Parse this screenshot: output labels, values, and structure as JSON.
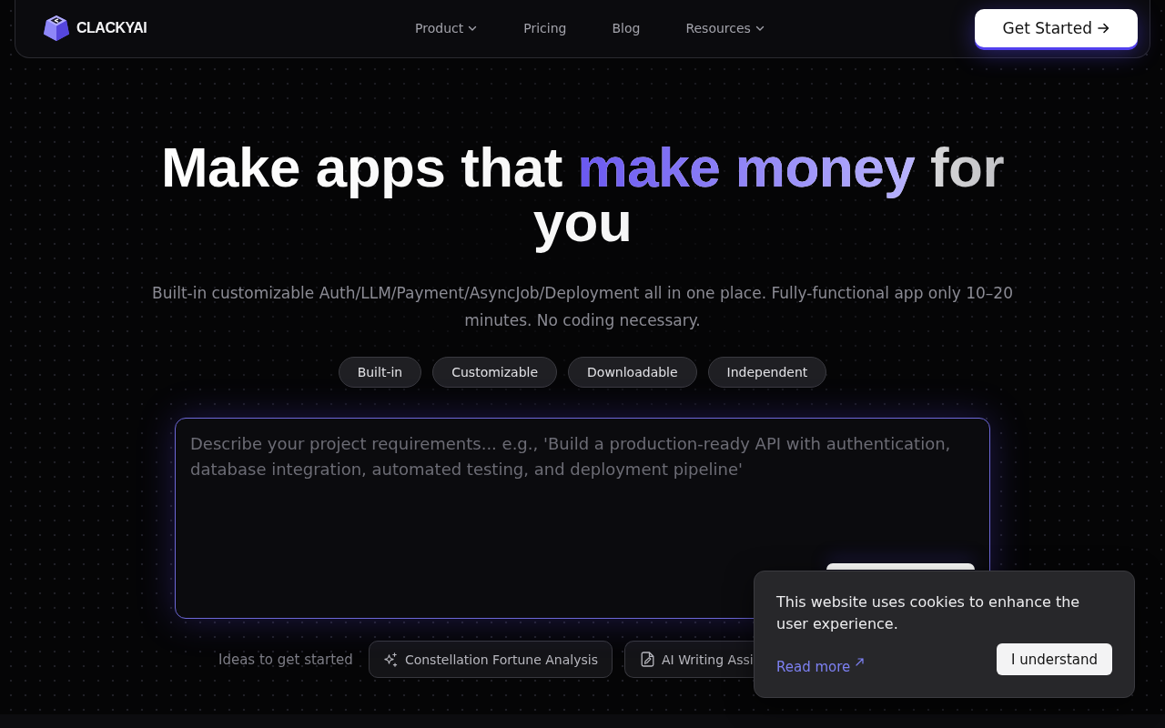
{
  "nav": {
    "logo": "CLACKYAI",
    "links": [
      {
        "label": "Product",
        "dropdown": true
      },
      {
        "label": "Pricing",
        "dropdown": false
      },
      {
        "label": "Blog",
        "dropdown": false
      },
      {
        "label": "Resources",
        "dropdown": true
      }
    ],
    "cta": "Get Started"
  },
  "hero": {
    "heading": [
      {
        "text": "Make apps that ",
        "kind": "plain"
      },
      {
        "text": "make money",
        "kind": "accent"
      },
      {
        "text": " for you",
        "kind": "plain"
      }
    ],
    "subtitle": "Built-in customizable Auth/LLM/Payment/AsyncJob/Deployment all in one place. Fully-functional app only 10–20 minutes. No coding necessary.",
    "tags": [
      "Built-in",
      "Customizable",
      "Downloadable",
      "Independent"
    ]
  },
  "prompt": {
    "placeholder": "Describe your project requirements... e.g., 'Build a production-ready API with authentication, database integration, automated testing, and deployment pipeline'"
  },
  "ideas": {
    "label": "Ideas to get started",
    "items": [
      {
        "label": "Constellation Fortune Analysis",
        "kind": "sparkle"
      },
      {
        "label": "AI Writing Assi",
        "kind": "document"
      }
    ]
  },
  "cookie_banner": {
    "message": "This website uses cookies to enhance the user experience.",
    "link": "Read more",
    "button": "I understand"
  }
}
